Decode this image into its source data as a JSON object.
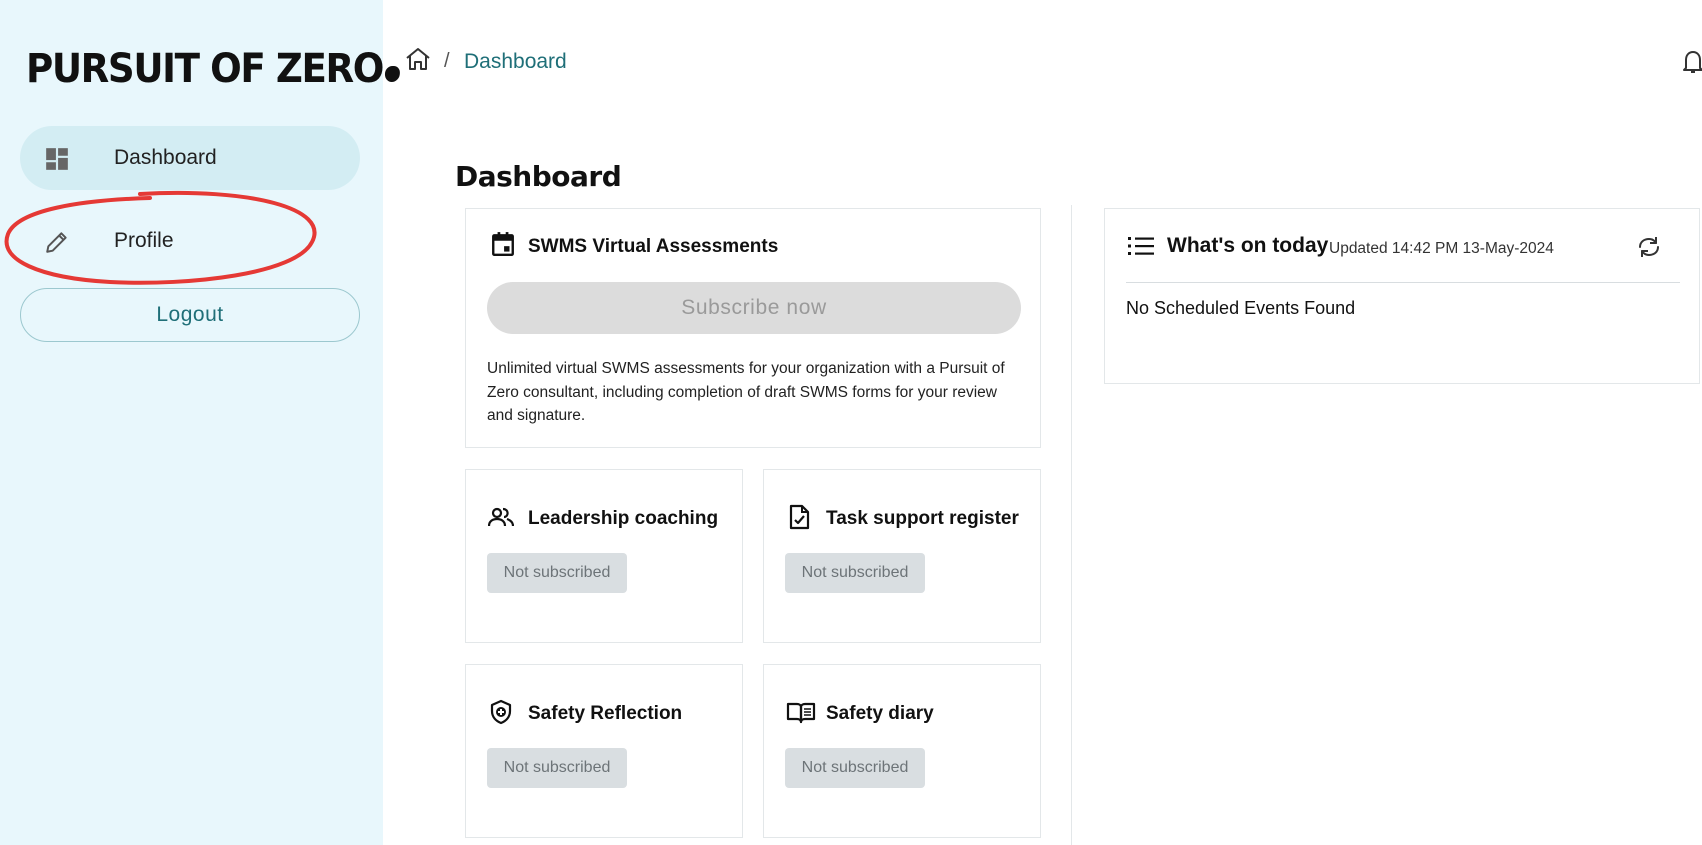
{
  "sidebar": {
    "logo_text": "PURSUIT OF ZERO",
    "items": [
      {
        "label": "Dashboard",
        "icon": "dashboard-icon",
        "active": true
      },
      {
        "label": "Profile",
        "icon": "pencil-icon",
        "active": false
      }
    ],
    "logout_label": "Logout"
  },
  "header": {
    "breadcrumb_sep": "/",
    "breadcrumb_current": "Dashboard"
  },
  "main": {
    "title": "Dashboard",
    "swms": {
      "title": "SWMS Virtual Assessments",
      "button_label": "Subscribe now",
      "description": "Unlimited virtual SWMS assessments for your organization with a Pursuit of Zero consultant, including completion of draft SWMS forms for your review and signature."
    },
    "cards": [
      {
        "title": "Leadership coaching",
        "status": "Not subscribed",
        "icon": "people-icon"
      },
      {
        "title": "Task support register",
        "status": "Not subscribed",
        "icon": "document-check-icon"
      },
      {
        "title": "Safety Reflection",
        "status": "Not subscribed",
        "icon": "shield-plus-icon"
      },
      {
        "title": "Safety diary",
        "status": "Not subscribed",
        "icon": "open-book-icon"
      }
    ]
  },
  "today": {
    "title": "What's on today",
    "updated": "Updated 14:42 PM 13-May-2024",
    "empty_text": "No Scheduled Events Found"
  },
  "colors": {
    "sidebar_bg": "#e8f7fc",
    "active_nav_bg": "#d3edf3",
    "accent": "#1f6f78",
    "annotation": "#e53935"
  }
}
